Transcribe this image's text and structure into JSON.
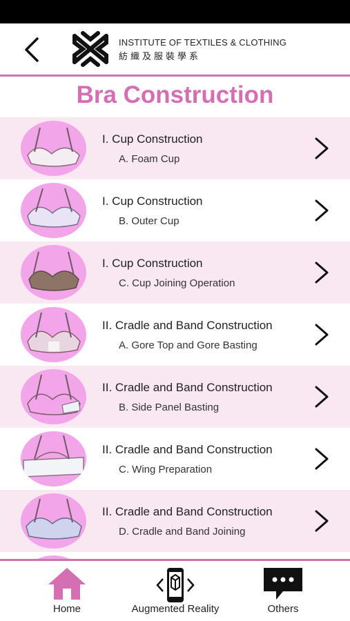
{
  "header": {
    "institute_en": "INSTITUTE OF TEXTILES & CLOTHING",
    "institute_zh": "紡織及服裝學系"
  },
  "page": {
    "title": "Bra Construction"
  },
  "items": [
    {
      "title": "I. Cup Construction",
      "subtitle": "A. Foam Cup"
    },
    {
      "title": "I. Cup Construction",
      "subtitle": "B. Outer Cup"
    },
    {
      "title": "I. Cup Construction",
      "subtitle": "C. Cup Joining Operation"
    },
    {
      "title": "II. Cradle and Band Construction",
      "subtitle": "A. Gore Top and Gore Basting"
    },
    {
      "title": "II. Cradle and Band Construction",
      "subtitle": "B. Side Panel Basting"
    },
    {
      "title": "II. Cradle and Band Construction",
      "subtitle": "C. Wing Preparation"
    },
    {
      "title": "II. Cradle and Band Construction",
      "subtitle": "D. Cradle and Band Joining"
    }
  ],
  "tabs": {
    "home": "Home",
    "ar": "Augmented Reality",
    "others": "Others"
  },
  "colors": {
    "accent": "#d46fb3",
    "row_pink": "#f9e7f2",
    "thumb_bg": "#f2a5e8"
  },
  "icons": {
    "back": "chevron-left-icon",
    "row_arrow": "chevron-right-icon",
    "home": "house-icon",
    "ar": "phone-ar-icon",
    "others": "chat-bubble-icon"
  }
}
